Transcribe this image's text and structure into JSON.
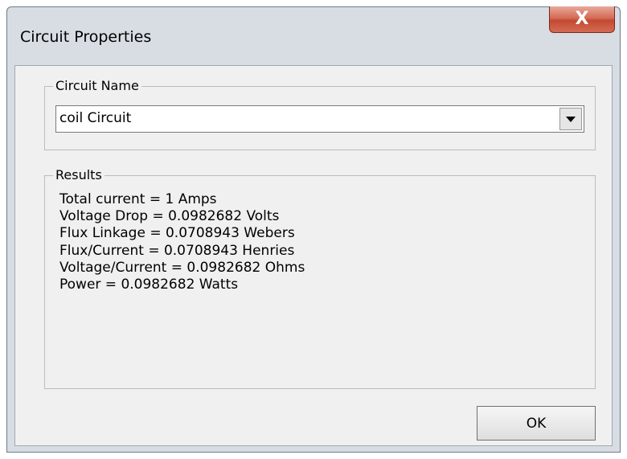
{
  "window": {
    "title": "Circuit Properties",
    "close_glyph": "X",
    "close_icon": "close-icon"
  },
  "circuit_name_group": {
    "label": "Circuit Name",
    "selected_value": "coil Circuit",
    "dropdown_icon": "chevron-down-icon"
  },
  "results_group": {
    "label": "Results",
    "lines": [
      "Total current = 1 Amps",
      "Voltage Drop = 0.0982682 Volts",
      "Flux Linkage = 0.0708943 Webers",
      "Flux/Current = 0.0708943 Henries",
      "Voltage/Current = 0.0982682 Ohms",
      "Power = 0.0982682 Watts"
    ]
  },
  "buttons": {
    "ok_label": "OK"
  },
  "colors": {
    "close_button": "#c44a30",
    "dialog_background": "#f0f0f0",
    "window_frame": "#d8dde4"
  }
}
